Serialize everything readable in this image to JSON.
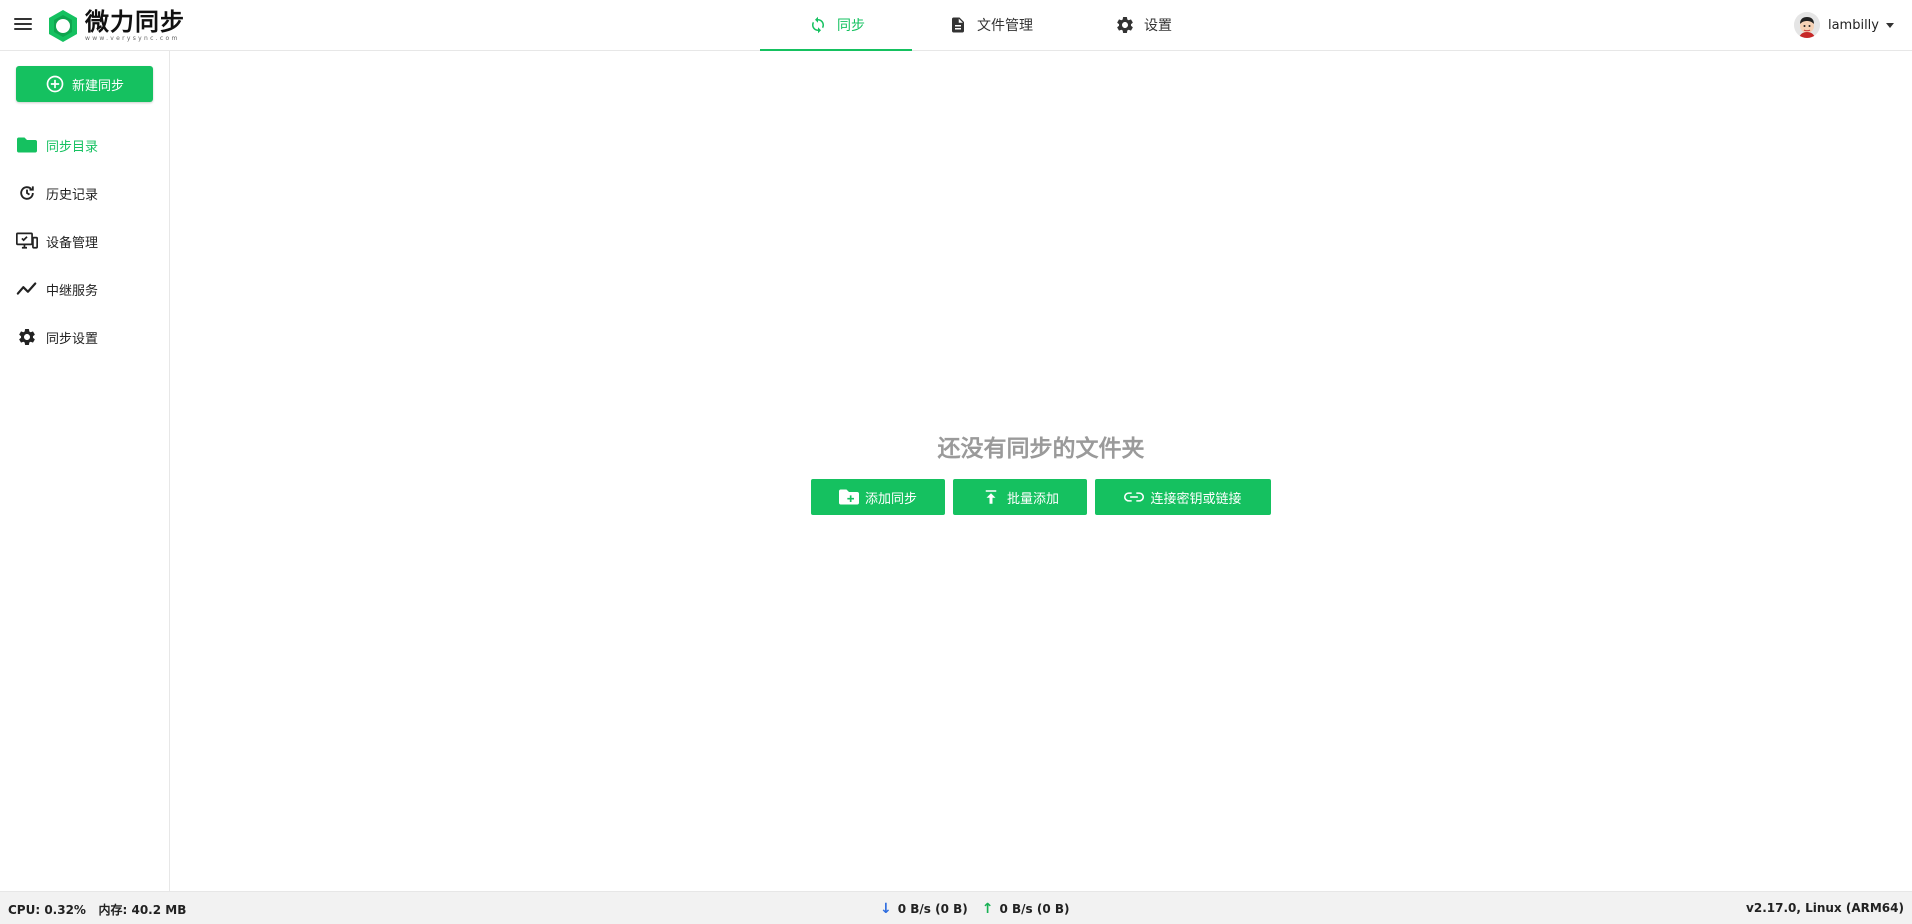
{
  "header": {
    "logo_title": "微力同步",
    "logo_sub": "www.verysync.com",
    "tabs": [
      {
        "label": "同步",
        "icon": "sync-icon",
        "active": true
      },
      {
        "label": "文件管理",
        "icon": "file-icon",
        "active": false
      },
      {
        "label": "设置",
        "icon": "gear-icon",
        "active": false
      }
    ],
    "user_name": "lambilly"
  },
  "sidebar": {
    "new_button": "新建同步",
    "items": [
      {
        "label": "同步目录",
        "icon": "folder-icon",
        "active": true
      },
      {
        "label": "历史记录",
        "icon": "history-icon"
      },
      {
        "label": "设备管理",
        "icon": "device-icon"
      },
      {
        "label": "中继服务",
        "icon": "relay-icon"
      },
      {
        "label": "同步设置",
        "icon": "gear-icon"
      }
    ]
  },
  "empty": {
    "title": "还没有同步的文件夹",
    "add_sync": "添加同步",
    "batch_add": "批量添加",
    "connect_key": "连接密钥或链接"
  },
  "status": {
    "cpu": "CPU: 0.32%",
    "memory": "内存: 40.2 MB",
    "download": "0 B/s (0 B)",
    "upload": "0 B/s (0 B)",
    "version": "v2.17.0, Linux (ARM64)"
  },
  "colors": {
    "accent": "#15c160"
  }
}
